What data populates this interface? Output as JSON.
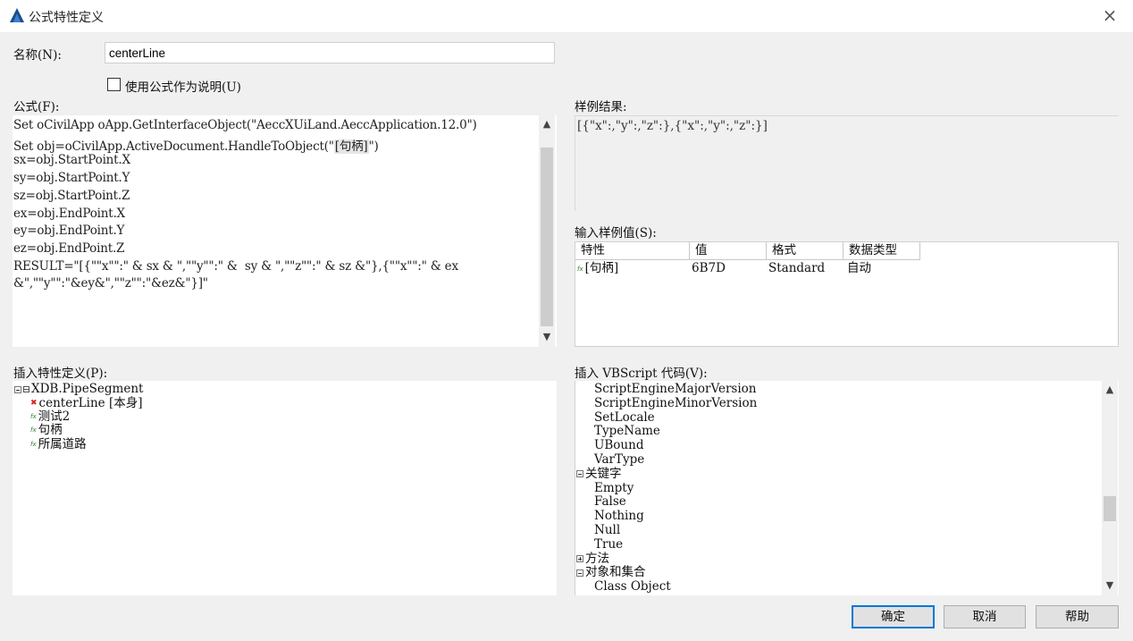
{
  "window": {
    "title": "公式特性定义",
    "close_icon": "close-icon",
    "app_icon": "autocad-a-icon"
  },
  "name_field": {
    "label": "名称(N):",
    "value": "centerLine"
  },
  "use_formula_checkbox": {
    "label": "使用公式作为说明(U)",
    "checked": false
  },
  "formula": {
    "label": "公式(F):",
    "lines": [
      [
        "Set oCivilApp oApp.GetInterfaceObject(\"AeccXUiLand.AeccApplication.12.0\")"
      ],
      [
        "Set obj=oCivilApp.ActiveDocument.HandleToObject(\"",
        "[句柄]",
        "\")"
      ],
      [
        "sx=obj.StartPoint.X"
      ],
      [
        "sy=obj.StartPoint.Y"
      ],
      [
        "sz=obj.StartPoint.Z"
      ],
      [
        "ex=obj.EndPoint.X"
      ],
      [
        "ey=obj.EndPoint.Y"
      ],
      [
        "ez=obj.EndPoint.Z"
      ],
      [
        "RESULT=\"[{\"\"x\"\":\" & sx & \",\"\"y\"\":\" &  sy & \",\"\"z\"\":\" & sz &\"},{\"\"x\"\":\" & ex"
      ],
      [
        "&\",\"\"y\"\":\"&ey&\",\"\"z\"\":\"&ez&\"}]\""
      ]
    ]
  },
  "sample_result": {
    "label": "样例结果:",
    "value": "[{\"x\":,\"y\":,\"z\":},{\"x\":,\"y\":,\"z\":}]"
  },
  "sample_values": {
    "label": "输入样例值(S):",
    "columns": [
      "特性",
      "值",
      "格式",
      "数据类型"
    ],
    "rows": [
      {
        "property": "[句柄]",
        "value": "6B7D",
        "format": "Standard",
        "type": "自动"
      }
    ]
  },
  "insert_property": {
    "label": "插入特性定义(P):",
    "root": "XDB.PipeSegment",
    "items": [
      {
        "icon": "error-x-icon",
        "text": "centerLine",
        "suffix": "[本身]"
      },
      {
        "icon": "formula-icon",
        "text": "测试2",
        "suffix": ""
      },
      {
        "icon": "formula-icon",
        "text": "句柄",
        "suffix": ""
      },
      {
        "icon": "formula-icon",
        "text": "所属道路",
        "suffix": ""
      }
    ]
  },
  "vbscript": {
    "label": "插入 VBScript 代码(V):",
    "rows": [
      {
        "kind": "leaf",
        "text": "ScriptEngineMajorVersion"
      },
      {
        "kind": "leaf",
        "text": "ScriptEngineMinorVersion"
      },
      {
        "kind": "leaf",
        "text": "SetLocale"
      },
      {
        "kind": "leaf",
        "text": "TypeName"
      },
      {
        "kind": "leaf",
        "text": "UBound"
      },
      {
        "kind": "leaf",
        "text": "VarType"
      },
      {
        "kind": "group",
        "text": "关键字",
        "expanded": true
      },
      {
        "kind": "leaf",
        "text": "Empty"
      },
      {
        "kind": "leaf",
        "text": "False"
      },
      {
        "kind": "leaf",
        "text": "Nothing"
      },
      {
        "kind": "leaf",
        "text": "Null"
      },
      {
        "kind": "leaf",
        "text": "True"
      },
      {
        "kind": "group",
        "text": "方法",
        "expanded": false
      },
      {
        "kind": "group",
        "text": "对象和集合",
        "expanded": true
      },
      {
        "kind": "leaf",
        "text": "Class Object"
      }
    ]
  },
  "buttons": {
    "ok": "确定",
    "cancel": "取消",
    "help": "帮助"
  }
}
